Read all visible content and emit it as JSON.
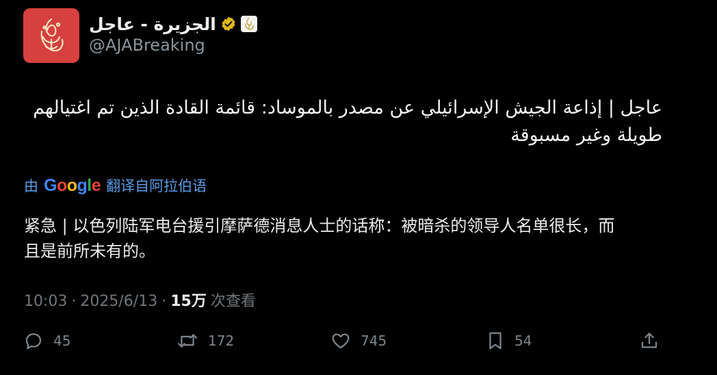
{
  "account": {
    "display_name": "الجزيرة - عاجل",
    "handle": "@AJABreaking"
  },
  "post": {
    "arabic_lines": [
      "عاجل | إذاعة الجيش الإسرائيلي عن مصدر بالموساد: قائمة القادة الذين تم اغتيالهم",
      "طويلة وغير مسبوقة"
    ],
    "translate_prefix": "由",
    "translate_brand": "Google",
    "translate_label": "翻译自阿拉伯语",
    "chinese_lines": [
      "紧急 | 以色列陆军电台援引摩萨德消息人士的话称：被暗杀的领导人名单很长，而",
      "且是前所未有的。"
    ],
    "time": "10:03",
    "date": "2025/6/13",
    "views_count": "15万",
    "views_label": "次查看"
  },
  "actions": {
    "replies": "45",
    "reposts": "172",
    "likes": "745",
    "bookmarks": "54"
  },
  "icons": {
    "avatar": "aljazeera-logo-icon",
    "verified": "gold-verified-badge-icon",
    "affiliate": "aljazeera-affiliate-badge-icon",
    "reply": "reply-icon",
    "repost": "repost-icon",
    "like": "heart-icon",
    "bookmark": "bookmark-icon",
    "share": "share-icon"
  },
  "colors": {
    "background": "#000000",
    "avatar_bg": "#d6403f",
    "verified_gold": "#e2b719",
    "link_blue": "#5a9ce6",
    "muted_text": "#71777d"
  }
}
